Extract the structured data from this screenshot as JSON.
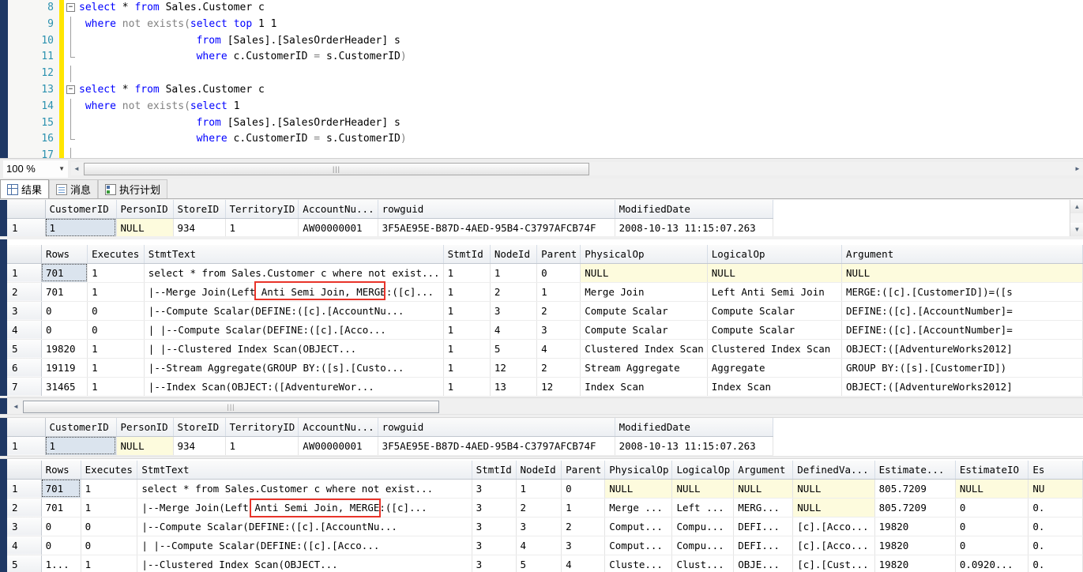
{
  "editor": {
    "lines": [
      {
        "num": "8",
        "fold": "minus",
        "text": "select * from Sales.Customer c",
        "tokens": [
          {
            "t": "select",
            "c": "kw"
          },
          {
            "t": " * ",
            "c": "plain"
          },
          {
            "t": "from",
            "c": "kw"
          },
          {
            "t": " Sales.Customer c",
            "c": "plain"
          }
        ]
      },
      {
        "num": "9",
        "fold": "line",
        "text": "where not exists(select top 1 1",
        "tokens": [
          {
            "t": " ",
            "c": "plain"
          },
          {
            "t": "where",
            "c": "kw"
          },
          {
            "t": " ",
            "c": "plain"
          },
          {
            "t": "not exists",
            "c": "gray"
          },
          {
            "t": "(",
            "c": "gray"
          },
          {
            "t": "select top",
            "c": "kw"
          },
          {
            "t": " 1 1",
            "c": "plain"
          }
        ]
      },
      {
        "num": "10",
        "fold": "line",
        "text": "from [Sales].[SalesOrderHeader] s",
        "indent": 19,
        "tokens": [
          {
            "t": "from",
            "c": "kw"
          },
          {
            "t": " [Sales].[SalesOrderHeader] s",
            "c": "plain"
          }
        ]
      },
      {
        "num": "11",
        "fold": "end",
        "text": "where c.CustomerID = s.CustomerID)",
        "indent": 19,
        "tokens": [
          {
            "t": "where",
            "c": "kw"
          },
          {
            "t": " c.CustomerID ",
            "c": "plain"
          },
          {
            "t": "=",
            "c": "gray"
          },
          {
            "t": " s.CustomerID",
            "c": "plain"
          },
          {
            "t": ")",
            "c": "gray"
          }
        ]
      },
      {
        "num": "12",
        "fold": "line",
        "text": "",
        "tokens": []
      },
      {
        "num": "13",
        "fold": "minus",
        "text": "select * from Sales.Customer c",
        "tokens": [
          {
            "t": "select",
            "c": "kw"
          },
          {
            "t": " * ",
            "c": "plain"
          },
          {
            "t": "from",
            "c": "kw"
          },
          {
            "t": " Sales.Customer c",
            "c": "plain"
          }
        ]
      },
      {
        "num": "14",
        "fold": "line",
        "text": "where not exists(select 1",
        "tokens": [
          {
            "t": " ",
            "c": "plain"
          },
          {
            "t": "where",
            "c": "kw"
          },
          {
            "t": " ",
            "c": "plain"
          },
          {
            "t": "not exists",
            "c": "gray"
          },
          {
            "t": "(",
            "c": "gray"
          },
          {
            "t": "select",
            "c": "kw"
          },
          {
            "t": " 1",
            "c": "plain"
          }
        ]
      },
      {
        "num": "15",
        "fold": "line",
        "text": "from [Sales].[SalesOrderHeader] s",
        "indent": 19,
        "tokens": [
          {
            "t": "from",
            "c": "kw"
          },
          {
            "t": " [Sales].[SalesOrderHeader] s",
            "c": "plain"
          }
        ]
      },
      {
        "num": "16",
        "fold": "end",
        "text": "where c.CustomerID = s.CustomerID)",
        "indent": 19,
        "tokens": [
          {
            "t": "where",
            "c": "kw"
          },
          {
            "t": " c.CustomerID ",
            "c": "plain"
          },
          {
            "t": "=",
            "c": "gray"
          },
          {
            "t": " s.CustomerID",
            "c": "plain"
          },
          {
            "t": ")",
            "c": "gray"
          }
        ]
      },
      {
        "num": "17",
        "fold": "line",
        "text": "",
        "tokens": []
      }
    ]
  },
  "zoombar": {
    "zoom_level": "100 %",
    "dropdown_arrow": "▼",
    "left_arrow": "◄",
    "right_arrow": "►",
    "thumb_grip": "|||"
  },
  "tabs": [
    {
      "label": "结果",
      "icon": "grid-icon",
      "active": true
    },
    {
      "label": "消息",
      "icon": "message-icon",
      "active": false
    },
    {
      "label": "执行计划",
      "icon": "execution-plan-icon",
      "active": false
    }
  ],
  "grid1": {
    "columns": [
      "",
      "CustomerID",
      "PersonID",
      "StoreID",
      "TerritoryID",
      "AccountNu...",
      "rowguid",
      "ModifiedDate"
    ],
    "widths": [
      48,
      90,
      72,
      66,
      90,
      100,
      300,
      200
    ],
    "rows": [
      {
        "num": "1",
        "cells": [
          "1",
          "NULL",
          "934",
          "1",
          "AW00000001",
          "3F5AE95E-B87D-4AED-95B4-C3797AFCB74F",
          "2008-10-13 11:15:07.263"
        ],
        "cur_index": 0,
        "null_index": 1
      }
    ],
    "scroll_up": "▲",
    "scroll_down": "▼"
  },
  "grid2": {
    "columns": [
      "",
      "Rows",
      "Executes",
      "StmtText",
      "StmtId",
      "NodeId",
      "Parent",
      "PhysicalOp",
      "LogicalOp",
      "Argument"
    ],
    "widths": [
      48,
      60,
      72,
      330,
      60,
      60,
      52,
      152,
      172,
      320
    ],
    "rows": [
      {
        "num": "1",
        "cells": [
          "701",
          "1",
          "select * from Sales.Customer c  where not exist...",
          "1",
          "1",
          "0",
          "NULL",
          "NULL",
          "NULL"
        ],
        "cur_index": 0,
        "null_cols": [
          6,
          7,
          8
        ]
      },
      {
        "num": "2",
        "cells": [
          "701",
          "1",
          "    |--Merge Join(Left Anti Semi Join, MERGE:([c]...",
          "1",
          "2",
          "1",
          "Merge Join",
          "Left Anti Semi Join",
          "MERGE:([c].[CustomerID])=([s"
        ],
        "null_cols": []
      },
      {
        "num": "3",
        "cells": [
          "0",
          "0",
          "         |--Compute Scalar(DEFINE:([c].[AccountNu...",
          "1",
          "3",
          "2",
          "Compute Scalar",
          "Compute Scalar",
          "DEFINE:([c].[AccountNumber]="
        ],
        "null_cols": []
      },
      {
        "num": "4",
        "cells": [
          "0",
          "0",
          "         |    |--Compute Scalar(DEFINE:([c].[Acco...",
          "1",
          "4",
          "3",
          "Compute Scalar",
          "Compute Scalar",
          "DEFINE:([c].[AccountNumber]="
        ],
        "null_cols": []
      },
      {
        "num": "5",
        "cells": [
          "19820",
          "1",
          "         |         |--Clustered Index Scan(OBJECT...",
          "1",
          "5",
          "4",
          "Clustered Index Scan",
          "Clustered Index Scan",
          "OBJECT:([AdventureWorks2012]"
        ],
        "null_cols": []
      },
      {
        "num": "6",
        "cells": [
          "19119",
          "1",
          "         |--Stream Aggregate(GROUP BY:([s].[Custo...",
          "1",
          "12",
          "2",
          "Stream Aggregate",
          "Aggregate",
          "GROUP BY:([s].[CustomerID])"
        ],
        "null_cols": []
      },
      {
        "num": "7",
        "cells": [
          "31465",
          "1",
          "              |--Index Scan(OBJECT:([AdventureWor...",
          "1",
          "13",
          "12",
          "Index Scan",
          "Index Scan",
          "OBJECT:([AdventureWorks2012]"
        ],
        "null_cols": []
      }
    ],
    "annotation": {
      "label": "Left Anti Semi Join,",
      "color": "#e8342a"
    }
  },
  "grid3": {
    "columns": [
      "",
      "CustomerID",
      "PersonID",
      "StoreID",
      "TerritoryID",
      "AccountNu...",
      "rowguid",
      "ModifiedDate"
    ],
    "widths": [
      48,
      90,
      72,
      66,
      90,
      100,
      300,
      200
    ],
    "rows": [
      {
        "num": "1",
        "cells": [
          "1",
          "NULL",
          "934",
          "1",
          "AW00000001",
          "3F5AE95E-B87D-4AED-95B4-C3797AFCB74F",
          "2008-10-13 11:15:07.263"
        ],
        "cur_index": 0,
        "null_index": 1
      }
    ]
  },
  "grid4": {
    "columns": [
      "",
      "Rows",
      "Executes",
      "StmtText",
      "StmtId",
      "NodeId",
      "Parent",
      "PhysicalOp",
      "LogicalOp",
      "Argument",
      "DefinedVa...",
      "Estimate...",
      "EstimateIO",
      "Es"
    ],
    "widths": [
      48,
      52,
      72,
      432,
      56,
      58,
      54,
      80,
      74,
      76,
      104,
      104,
      94,
      77
    ],
    "rows": [
      {
        "num": "1",
        "cells": [
          "701",
          "1",
          "select * from Sales.Customer c  where not exist...",
          "3",
          "1",
          "0",
          "NULL",
          "NULL",
          "NULL",
          "NULL",
          "805.7209",
          "NULL",
          "NU"
        ],
        "cur_index": 0,
        "null_cols": [
          6,
          7,
          8,
          9,
          11,
          12
        ]
      },
      {
        "num": "2",
        "cells": [
          "701",
          "1",
          "    |--Merge Join(Left Anti Semi Join, MERGE:([c]...",
          "3",
          "2",
          "1",
          "Merge ...",
          "Left ...",
          "MERG...",
          "NULL",
          "805.7209",
          "0",
          "0."
        ],
        "null_cols": [
          9
        ]
      },
      {
        "num": "3",
        "cells": [
          "0",
          "0",
          "         |--Compute Scalar(DEFINE:([c].[AccountNu...",
          "3",
          "3",
          "2",
          "Comput...",
          "Compu...",
          "DEFI...",
          "[c].[Acco...",
          "19820",
          "0",
          "0."
        ],
        "null_cols": []
      },
      {
        "num": "4",
        "cells": [
          "0",
          "0",
          "         |    |--Compute Scalar(DEFINE:([c].[Acco...",
          "3",
          "4",
          "3",
          "Comput...",
          "Compu...",
          "DEFI...",
          "[c].[Acco...",
          "19820",
          "0",
          "0."
        ],
        "null_cols": []
      },
      {
        "num": "5",
        "cells": [
          "1...",
          "1",
          "              |--Clustered Index Scan(OBJECT...",
          "3",
          "5",
          "4",
          "Cluste...",
          "Clust...",
          "OBJE...",
          "[c].[Cust...",
          "19820",
          "0.0920...",
          "0."
        ],
        "null_cols": []
      }
    ],
    "annotation": {
      "label": "Left Anti Semi Join,",
      "color": "#e8342a"
    }
  },
  "hscroll_middle": {
    "left_arrow": "◄",
    "right_arrow": "►",
    "thumb_grip": "|||"
  }
}
